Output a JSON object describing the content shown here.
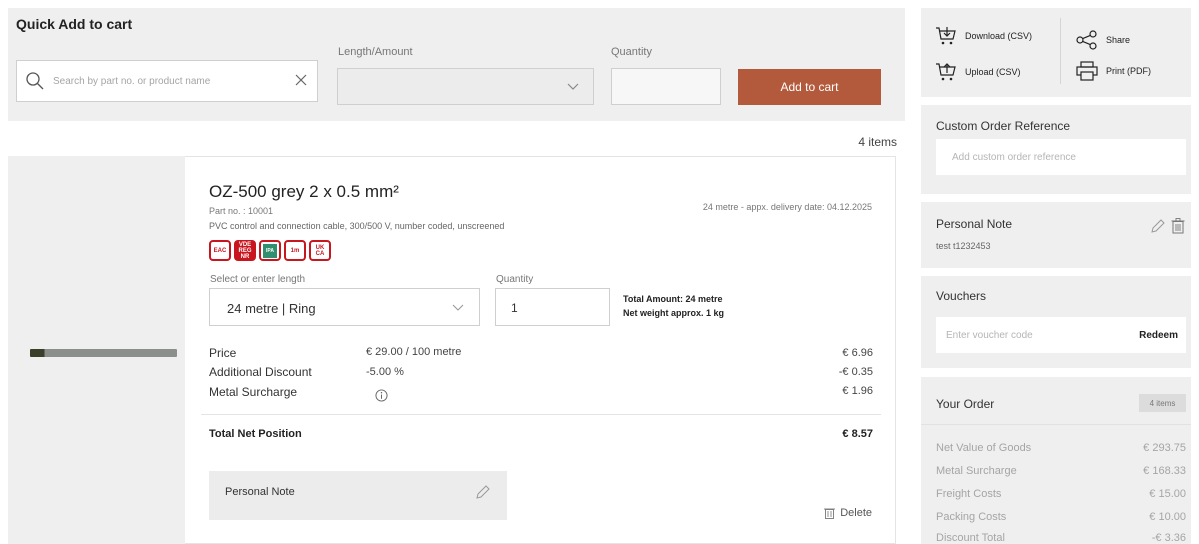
{
  "quick_add": {
    "title": "Quick Add to cart",
    "search_placeholder": "Search by part no. or product name",
    "length_label": "Length/Amount",
    "quantity_label": "Quantity",
    "add_button": "Add to cart"
  },
  "items_count": "4 items",
  "product": {
    "title": "OZ-500 grey 2 x 0.5 mm²",
    "part_no": "Part no. : 10001",
    "description": "PVC control and connection cable, 300/500 V, number coded, unscreened",
    "delivery": "24 metre - appx. delivery date:  04.12.2025",
    "certifications": [
      "EAC",
      "VDE REG NR",
      "IPA",
      "1m",
      "UK CA"
    ],
    "select_length_label": "Select or enter length",
    "length_value": "24 metre | Ring",
    "quantity_label": "Quantity",
    "quantity_value": "1",
    "total_amount": "Total Amount: 24 metre",
    "net_weight": "Net weight approx. 1 kg",
    "price_rows": [
      {
        "label": "Price",
        "mid": "€ 29.00 / 100 metre",
        "value": "€ 6.96"
      },
      {
        "label": "Additional Discount",
        "mid": "-5.00 %",
        "value": "-€ 0.35"
      },
      {
        "label": "Metal Surcharge",
        "mid": "",
        "value": "€ 1.96"
      }
    ],
    "total_net_label": "Total Net Position",
    "total_net_value": "€ 8.57",
    "personal_note_label": "Personal Note",
    "delete_label": "Delete",
    "accent_color": "#c8151e"
  },
  "sidebar": {
    "download": "Download (CSV)",
    "share": "Share",
    "upload": "Upload (CSV)",
    "print": "Print (PDF)",
    "custom_ref_title": "Custom Order Reference",
    "custom_ref_placeholder": "Add custom order reference",
    "personal_note_title": "Personal Note",
    "personal_note_text": "test t1232453",
    "vouchers_title": "Vouchers",
    "voucher_placeholder": "Enter voucher code",
    "redeem": "Redeem",
    "your_order_title": "Your Order",
    "your_order_badge": "4 items",
    "order_rows": [
      {
        "label": "Net Value of Goods",
        "value": "€ 293.75"
      },
      {
        "label": "Metal Surcharge",
        "value": "€ 168.33"
      },
      {
        "label": "Freight Costs",
        "value": "€ 15.00"
      },
      {
        "label": "Packing Costs",
        "value": "€ 10.00"
      },
      {
        "label": "Discount Total",
        "value": "-€ 3.36"
      }
    ]
  },
  "colors": {
    "button": "#b45a3c",
    "panel": "#efefef"
  }
}
